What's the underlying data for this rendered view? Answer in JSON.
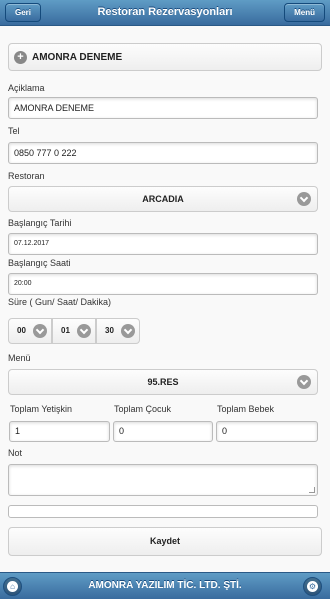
{
  "header": {
    "title": "Restoran Rezervasyonları",
    "back_label": "Geri",
    "menu_label": "Menü"
  },
  "collapsible": {
    "label": "AMONRA DENEME",
    "icon": "plus-icon"
  },
  "form": {
    "aciklama_label": "Açiklama",
    "aciklama_value": "AMONRA DENEME",
    "tel_label": "Tel",
    "tel_value": "0850 777 0 222",
    "restoran_label": "Restoran",
    "restoran_value": "ARCADIA",
    "baslangic_tarihi_label": "Başlangıç Tarihi",
    "baslangic_tarihi_value": "07.12.2017",
    "baslangic_saati_label": "Başlangıç Saati",
    "baslangic_saati_value": "20:00",
    "sure_label": "Süre ( Gun/ Saat/ Dakika)",
    "sure_gun": "00",
    "sure_saat": "01",
    "sure_dakika": "30",
    "menu_label": "Menü",
    "menu_value": "95.RES",
    "toplam_yetiskin_label": "Toplam Yetişkin",
    "toplam_yetiskin_value": "1",
    "toplam_cocuk_label": "Toplam Çocuk",
    "toplam_cocuk_value": "0",
    "toplam_bebek_label": "Toplam Bebek",
    "toplam_bebek_value": "0",
    "not_label": "Not",
    "not_value": "",
    "save_label": "Kaydet"
  },
  "footer": {
    "title": "AMONRA YAZILIM TİC. LTD. ŞTİ.",
    "left_icon": "home-icon",
    "right_icon": "gear-icon"
  },
  "colors": {
    "bar": "#396b9e",
    "bar_light": "#5f9cc5",
    "button_bg": "#eeeeee"
  }
}
